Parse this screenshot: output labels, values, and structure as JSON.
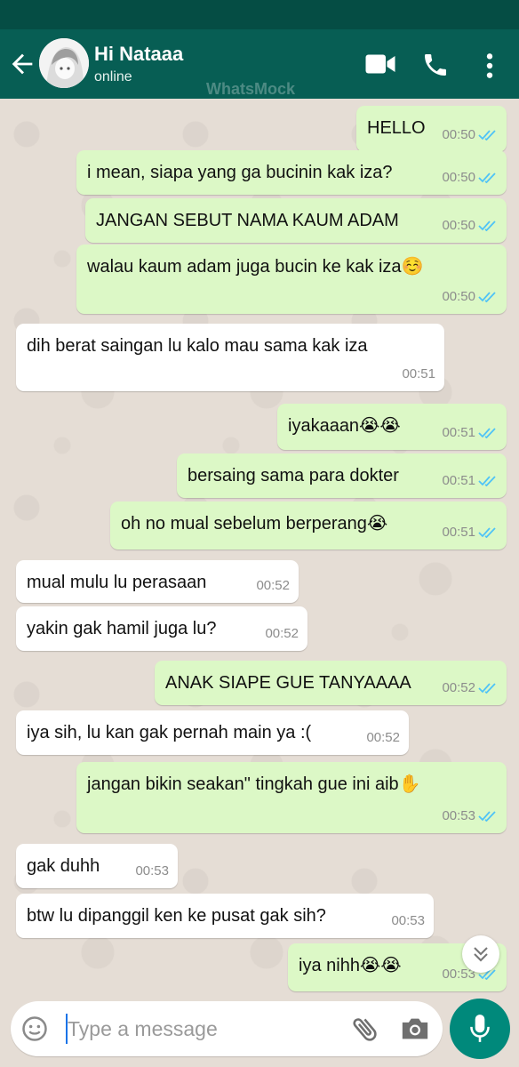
{
  "header": {
    "contact_name": "Hi Nataaa",
    "status": "online",
    "watermark": "WhatsMock"
  },
  "colors": {
    "header": "#075e54",
    "status_bar": "#054d44",
    "outgoing_bubble": "#dcf8c6",
    "incoming_bubble": "#ffffff",
    "chat_background": "#e5ddd5",
    "read_ticks": "#4fc3f7",
    "mic_button": "#00897b"
  },
  "icons": {
    "back": "arrow-left-icon",
    "video": "video-camera-icon",
    "call": "phone-icon",
    "menu": "more-vert-icon",
    "emoji": "emoji-icon",
    "attach": "paperclip-icon",
    "camera": "camera-icon",
    "mic": "microphone-icon",
    "scroll_down": "chevron-double-down-icon",
    "read_receipt": "double-check-icon"
  },
  "messages": [
    {
      "dir": "out",
      "text": "HELLO",
      "time": "00:50",
      "read": true
    },
    {
      "dir": "out",
      "text": "i mean, siapa yang ga bucinin kak iza?",
      "time": "00:50",
      "read": true
    },
    {
      "dir": "out",
      "text": "JANGAN SEBUT NAMA KAUM ADAM",
      "time": "00:50",
      "read": true
    },
    {
      "dir": "out",
      "text": "walau kaum adam juga bucin ke kak iza☺️",
      "time": "00:50",
      "read": true
    },
    {
      "dir": "in",
      "text": "dih berat saingan lu kalo mau sama kak iza",
      "time": "00:51"
    },
    {
      "dir": "out",
      "text": "iyakaaan😭😭",
      "time": "00:51",
      "read": true
    },
    {
      "dir": "out",
      "text": "bersaing sama para dokter",
      "time": "00:51",
      "read": true
    },
    {
      "dir": "out",
      "text": "oh no mual sebelum berperang😭",
      "time": "00:51",
      "read": true
    },
    {
      "dir": "in",
      "text": "mual mulu lu perasaan",
      "time": "00:52"
    },
    {
      "dir": "in",
      "text": "yakin gak hamil juga lu?",
      "time": "00:52"
    },
    {
      "dir": "out",
      "text": "ANAK SIAPE GUE TANYAAAA",
      "time": "00:52",
      "read": true
    },
    {
      "dir": "in",
      "text": "iya sih, lu kan gak pernah main ya :(",
      "time": "00:52"
    },
    {
      "dir": "out",
      "text": "jangan bikin seakan\" tingkah gue ini aib✋",
      "time": "00:53",
      "read": true
    },
    {
      "dir": "in",
      "text": "gak duhh",
      "time": "00:53"
    },
    {
      "dir": "in",
      "text": "btw lu dipanggil ken ke pusat gak sih?",
      "time": "00:53"
    },
    {
      "dir": "out",
      "text": "iya nihh😭😭",
      "time": "00:53",
      "read": true
    }
  ],
  "composer": {
    "placeholder": "Type a message",
    "value": ""
  }
}
